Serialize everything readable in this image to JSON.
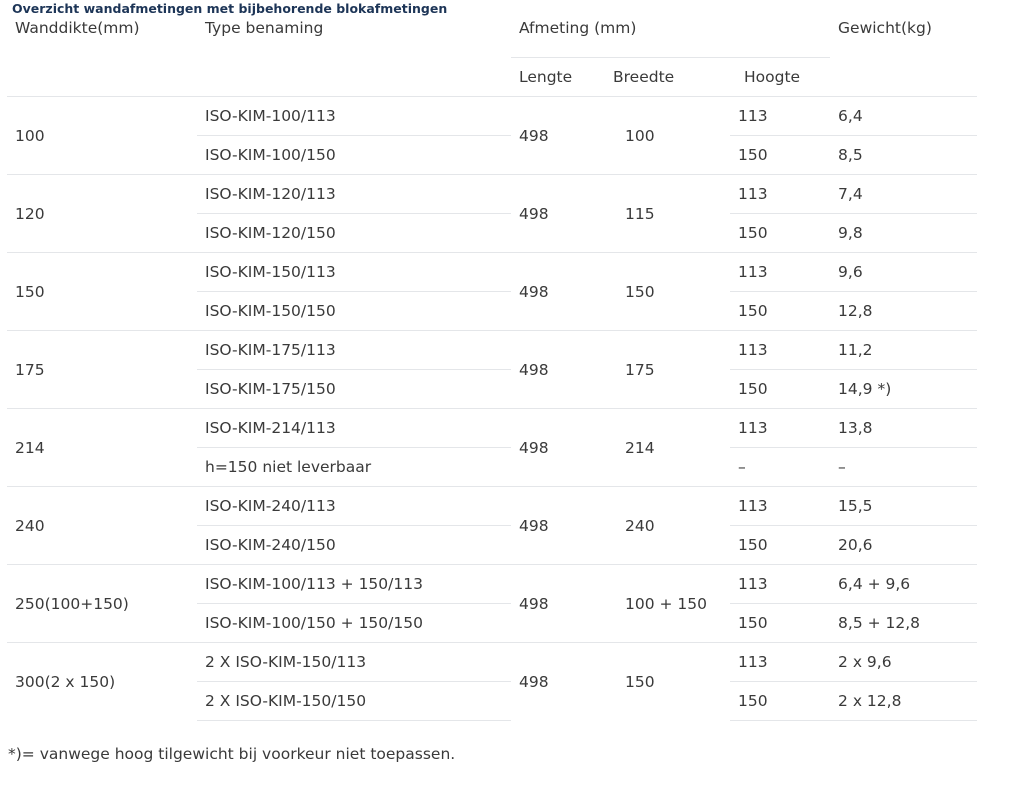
{
  "title": "Overzicht wandafmetingen met bijbehorende blokafmetingen",
  "headers": {
    "wanddikte": "Wanddikte(mm)",
    "type": "Type benaming",
    "afmeting": "Afmeting (mm)",
    "gewicht": "Gewicht(kg)",
    "lengte": "Lengte",
    "breedte": "Breedte",
    "hoogte": "Hoogte"
  },
  "groups": [
    {
      "wanddikte": "100",
      "lengte": "498",
      "breedte": "100",
      "rows": [
        {
          "type": "ISO-KIM-100/113",
          "hoogte": "113",
          "gewicht": "6,4"
        },
        {
          "type": "ISO-KIM-100/150",
          "hoogte": "150",
          "gewicht": "8,5"
        }
      ]
    },
    {
      "wanddikte": "120",
      "lengte": "498",
      "breedte": "115",
      "rows": [
        {
          "type": "ISO-KIM-120/113",
          "hoogte": "113",
          "gewicht": "7,4"
        },
        {
          "type": "ISO-KIM-120/150",
          "hoogte": "150",
          "gewicht": "9,8"
        }
      ]
    },
    {
      "wanddikte": "150",
      "lengte": "498",
      "breedte": "150",
      "rows": [
        {
          "type": "ISO-KIM-150/113",
          "hoogte": "113",
          "gewicht": "9,6"
        },
        {
          "type": "ISO-KIM-150/150",
          "hoogte": "150",
          "gewicht": "12,8"
        }
      ]
    },
    {
      "wanddikte": "175",
      "lengte": "498",
      "breedte": "175",
      "rows": [
        {
          "type": "ISO-KIM-175/113",
          "hoogte": "113",
          "gewicht": "11,2"
        },
        {
          "type": "ISO-KIM-175/150",
          "hoogte": "150",
          "gewicht": "14,9 *)"
        }
      ]
    },
    {
      "wanddikte": "214",
      "lengte": "498",
      "breedte": "214",
      "rows": [
        {
          "type": "ISO-KIM-214/113",
          "hoogte": "113",
          "gewicht": "13,8"
        },
        {
          "type": "h=150 niet leverbaar",
          "hoogte": "–",
          "gewicht": "–"
        }
      ]
    },
    {
      "wanddikte": "240",
      "lengte": "498",
      "breedte": "240",
      "rows": [
        {
          "type": "ISO-KIM-240/113",
          "hoogte": "113",
          "gewicht": "15,5"
        },
        {
          "type": "ISO-KIM-240/150",
          "hoogte": "150",
          "gewicht": "20,6"
        }
      ]
    },
    {
      "wanddikte": "250(100+150)",
      "lengte": "498",
      "breedte": "100 + 150",
      "rows": [
        {
          "type": "ISO-KIM-100/113 + 150/113",
          "hoogte": "113",
          "gewicht": "6,4 + 9,6"
        },
        {
          "type": "ISO-KIM-100/150 + 150/150",
          "hoogte": "150",
          "gewicht": "8,5 + 12,8"
        }
      ]
    },
    {
      "wanddikte": "300(2 x 150)",
      "lengte": "498",
      "breedte": "150",
      "rows": [
        {
          "type": "2 X ISO-KIM-150/113",
          "hoogte": "113",
          "gewicht": "2 x 9,6"
        },
        {
          "type": "2 X ISO-KIM-150/150",
          "hoogte": "150",
          "gewicht": "2 x 12,8"
        }
      ]
    }
  ],
  "footnote": "*)= vanwege hoog tilgewicht bij voorkeur niet toepassen."
}
